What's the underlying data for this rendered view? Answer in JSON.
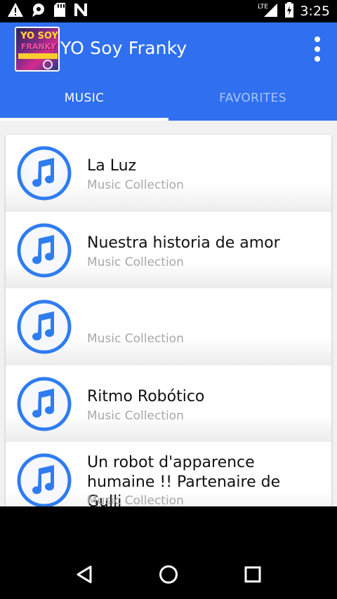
{
  "status_bar": {
    "time": "3:25",
    "network": "LTE",
    "icons": [
      "warning-icon",
      "chat-icon",
      "sd-card-icon",
      "n-app-icon",
      "signal-icon",
      "battery-charging-icon"
    ]
  },
  "app": {
    "title": "YO Soy Franky",
    "logo_text_1": "YO SOY",
    "logo_text_2": "FRANKY",
    "overflow_icon": "more-vert-icon"
  },
  "tabs": [
    {
      "label": "MUSIC",
      "active": true
    },
    {
      "label": "FAVORITES",
      "active": false
    }
  ],
  "tracks": [
    {
      "title": "La Luz",
      "subtitle": "Music Collection"
    },
    {
      "title": "Nuestra historia de amor",
      "subtitle": "Music Collection"
    },
    {
      "title": "",
      "subtitle": "Music Collection"
    },
    {
      "title": "Ritmo Robótico",
      "subtitle": "Music Collection"
    },
    {
      "title": "Un robot d'apparence humaine !!  Partenaire de Gulli",
      "subtitle": "Music Collection"
    }
  ],
  "nav_bar": {
    "icons": [
      "back-icon",
      "home-icon",
      "recents-icon"
    ]
  },
  "colors": {
    "primary": "#2f6ff0",
    "icon_blue": "#2f7cf0",
    "subtitle_gray": "#a7a7a7"
  }
}
